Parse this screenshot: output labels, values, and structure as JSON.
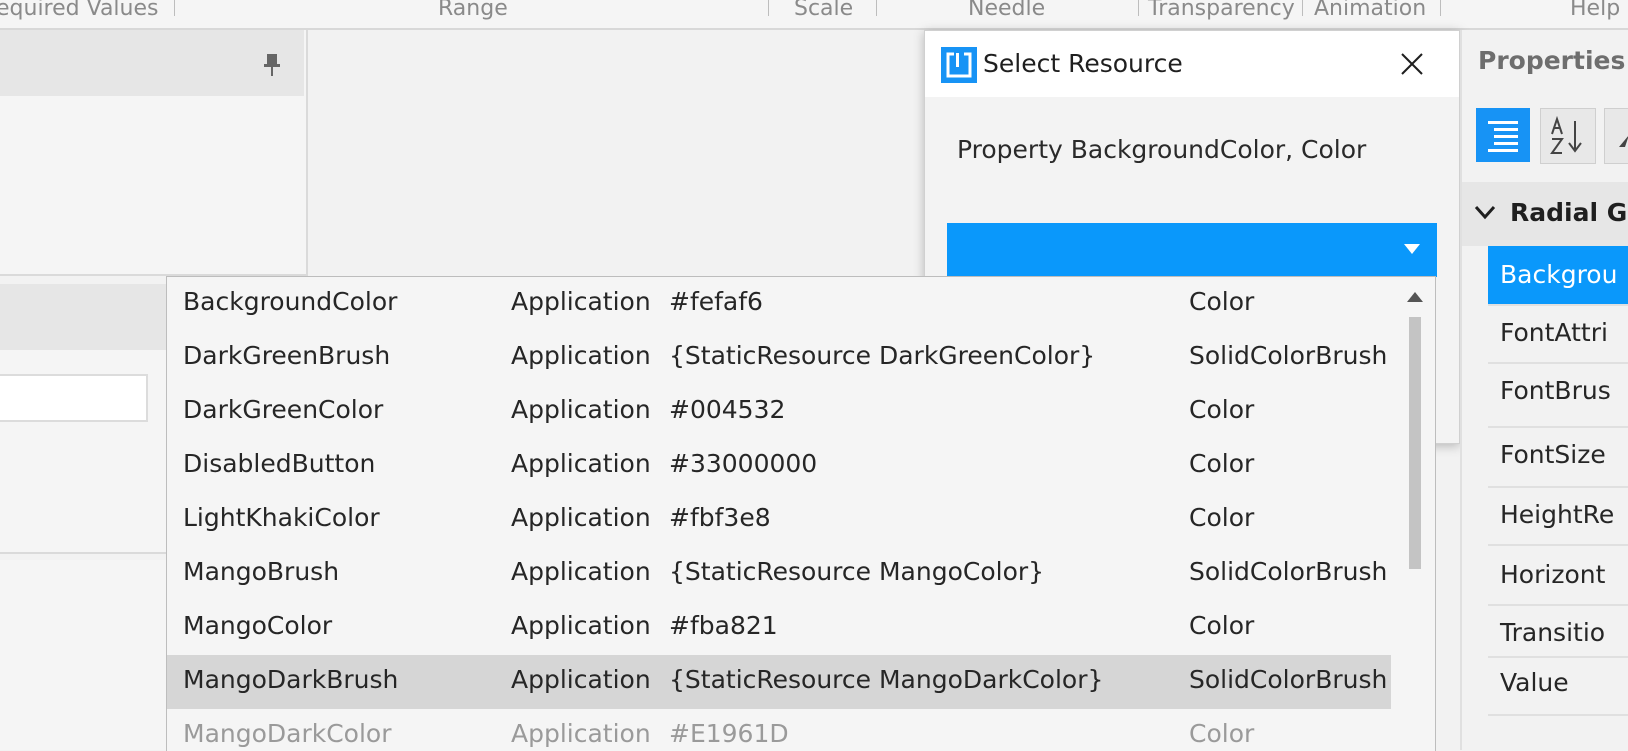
{
  "ribbon": {
    "groups": [
      "equired Values",
      "Range",
      "Scale",
      "Needle",
      "Transparency",
      "Animation",
      "Help"
    ]
  },
  "dialog": {
    "title": "Select Resource",
    "property_text": "Property BackgroundColor, Color",
    "combo_value": ""
  },
  "resources": [
    {
      "name": "BackgroundColor",
      "scope": "Application",
      "value": "#fefaf6",
      "type": "Color"
    },
    {
      "name": "DarkGreenBrush",
      "scope": "Application",
      "value": "{StaticResource DarkGreenColor}",
      "type": "SolidColorBrush"
    },
    {
      "name": "DarkGreenColor",
      "scope": "Application",
      "value": "#004532",
      "type": "Color"
    },
    {
      "name": "DisabledButton",
      "scope": "Application",
      "value": "#33000000",
      "type": "Color"
    },
    {
      "name": "LightKhakiColor",
      "scope": "Application",
      "value": "#fbf3e8",
      "type": "Color"
    },
    {
      "name": "MangoBrush",
      "scope": "Application",
      "value": "{StaticResource MangoColor}",
      "type": "SolidColorBrush"
    },
    {
      "name": "MangoColor",
      "scope": "Application",
      "value": "#fba821",
      "type": "Color"
    },
    {
      "name": "MangoDarkBrush",
      "scope": "Application",
      "value": "{StaticResource MangoDarkColor}",
      "type": "SolidColorBrush"
    },
    {
      "name": "MangoDarkColor",
      "scope": "Application",
      "value": "#E1961D",
      "type": "Color"
    }
  ],
  "properties": {
    "title": "Properties",
    "category": "Radial Ga",
    "items": [
      "Backgrou",
      "FontAttri",
      "FontBrus",
      "FontSize",
      "HeightRe",
      "Horizont",
      "Transitio",
      "Value"
    ]
  },
  "colors": {
    "accent": "#0a98fb",
    "selected_row": "#d6d6d6"
  }
}
